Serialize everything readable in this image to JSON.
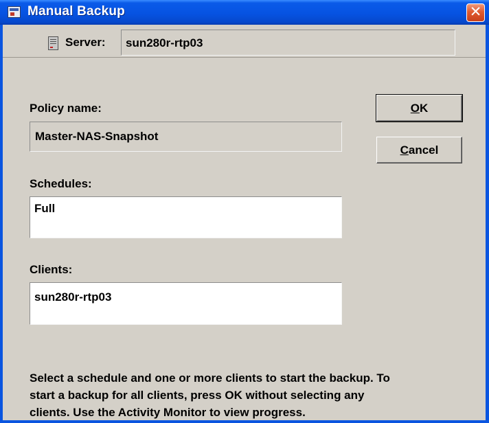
{
  "window": {
    "title": "Manual Backup",
    "close_symbol": "✕"
  },
  "server": {
    "label": "Server:",
    "value": "sun280r-rtp03",
    "icon": "server-icon"
  },
  "policy": {
    "label": "Policy name:",
    "value": "Master-NAS-Snapshot"
  },
  "schedules": {
    "label": "Schedules:",
    "items": [
      "Full"
    ]
  },
  "clients": {
    "label": "Clients:",
    "items": [
      "sun280r-rtp03"
    ]
  },
  "buttons": {
    "ok_label": "OK",
    "ok_mnemonic": "O",
    "ok_rest": "K",
    "cancel_label": "Cancel",
    "cancel_mnemonic": "C",
    "cancel_rest": "ancel"
  },
  "info": {
    "lines": [
      "Select a schedule and one or more clients to start the backup. To",
      "start a backup for all clients, press OK without selecting any",
      "clients. Use the Activity Monitor to view progress."
    ]
  },
  "colors": {
    "titlebar": "#0653e2",
    "dialog_bg": "#d4d0c8",
    "close_button": "#e05a30"
  }
}
